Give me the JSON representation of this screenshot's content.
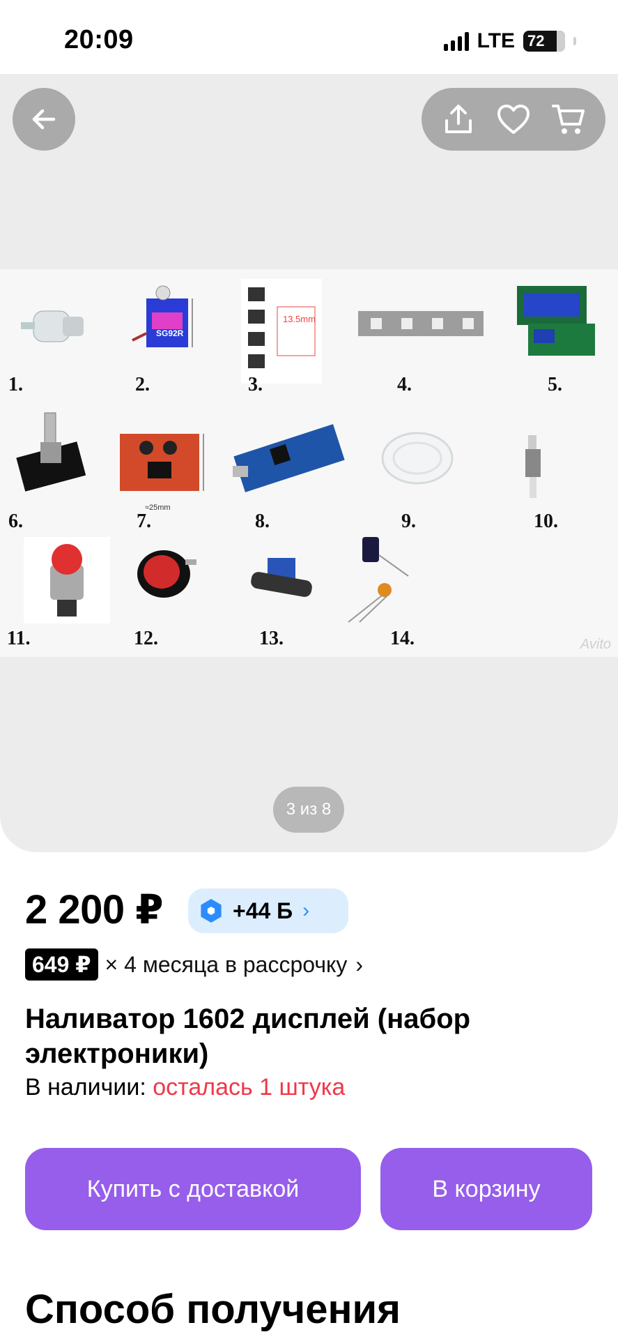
{
  "status_bar": {
    "time": "20:09",
    "network": "LTE",
    "battery": "72"
  },
  "gallery": {
    "page_indicator": "3 из 8",
    "watermark": "Avito",
    "part_labels": [
      "1.",
      "2.",
      "3.",
      "4.",
      "5.",
      "6.",
      "7.",
      "8.",
      "9.",
      "10.",
      "11.",
      "12.",
      "13.",
      "14."
    ],
    "annotations": {
      "switch_size": "13.5mm",
      "servo_model": "SG92R",
      "driver_size": "≈25mm"
    }
  },
  "icons": {
    "back": "back-arrow-icon",
    "share": "share-icon",
    "favorite": "heart-icon",
    "cart": "cart-icon"
  },
  "product": {
    "price": "2 200 ₽",
    "bonus": "+44 Б",
    "installment_amount": "649 ₽",
    "installment_text": "× 4 месяца в рассрочку",
    "title": "Наливатор 1602 дисплей (набор электроники)",
    "availability_label": "В наличии:",
    "availability_value": "осталась 1 штука"
  },
  "buttons": {
    "buy": "Купить с доставкой",
    "cart": "В корзину"
  },
  "section": {
    "title": "Способ получения"
  },
  "colors": {
    "accent": "#965eeb",
    "stock_red": "#f0384a",
    "bonus_blue": "#2c8cff",
    "bonus_bg": "#dceefd"
  }
}
